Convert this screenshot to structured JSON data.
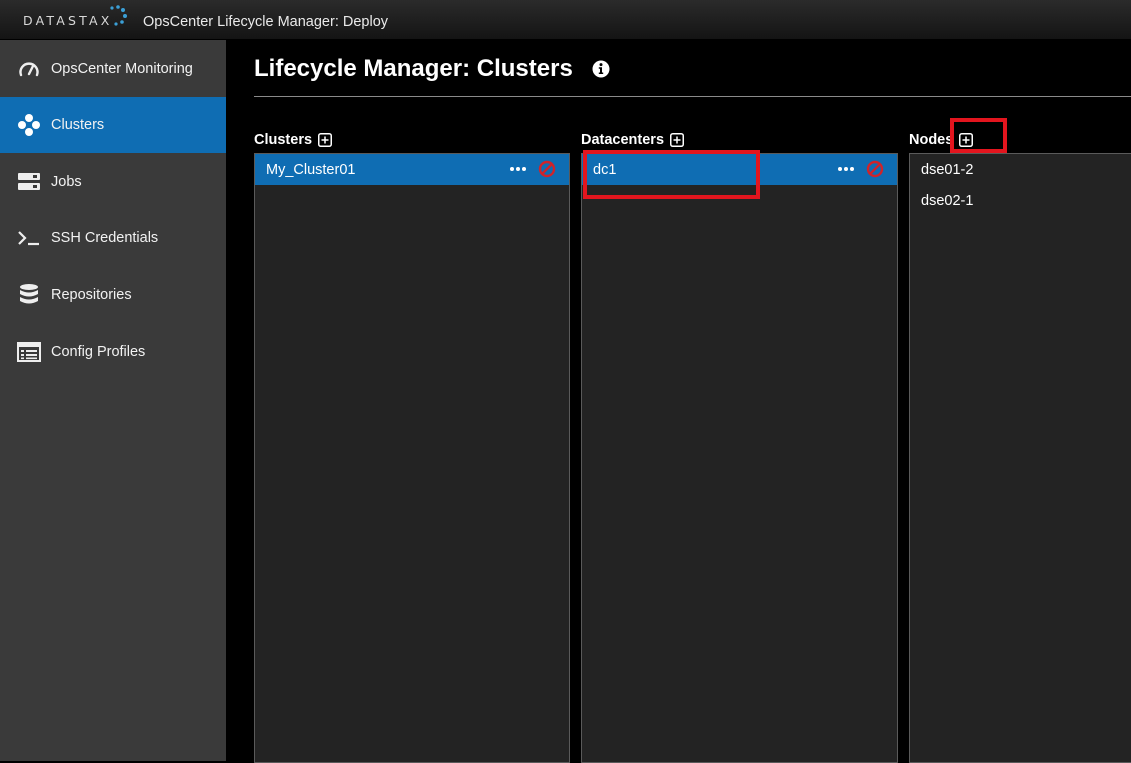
{
  "header": {
    "logo_text": "DATASTAX",
    "app_title": "OpsCenter Lifecycle Manager: Deploy"
  },
  "sidebar": {
    "items": [
      {
        "label": "OpsCenter Monitoring",
        "icon": "gauge-icon",
        "active": false
      },
      {
        "label": "Clusters",
        "icon": "clusters-icon",
        "active": true
      },
      {
        "label": "Jobs",
        "icon": "jobs-icon",
        "active": false
      },
      {
        "label": "SSH Credentials",
        "icon": "terminal-icon",
        "active": false
      },
      {
        "label": "Repositories",
        "icon": "database-icon",
        "active": false
      },
      {
        "label": "Config Profiles",
        "icon": "list-icon",
        "active": false
      }
    ]
  },
  "main": {
    "title": "Lifecycle Manager: Clusters",
    "columns": [
      {
        "header": "Clusters",
        "rows": [
          {
            "label": "My_Cluster01",
            "selected": true
          }
        ]
      },
      {
        "header": "Datacenters",
        "rows": [
          {
            "label": "dc1",
            "selected": true
          }
        ]
      },
      {
        "header": "Nodes",
        "rows": [
          {
            "label": "dse01-2",
            "selected": false
          },
          {
            "label": "dse02-1",
            "selected": false
          }
        ]
      }
    ]
  },
  "colors": {
    "accent": "#0f6db3",
    "sidebar_bg": "#3a3a3a",
    "panel_bg": "#232323",
    "highlight_box": "#e3151e",
    "delete_icon": "#d0232a"
  }
}
